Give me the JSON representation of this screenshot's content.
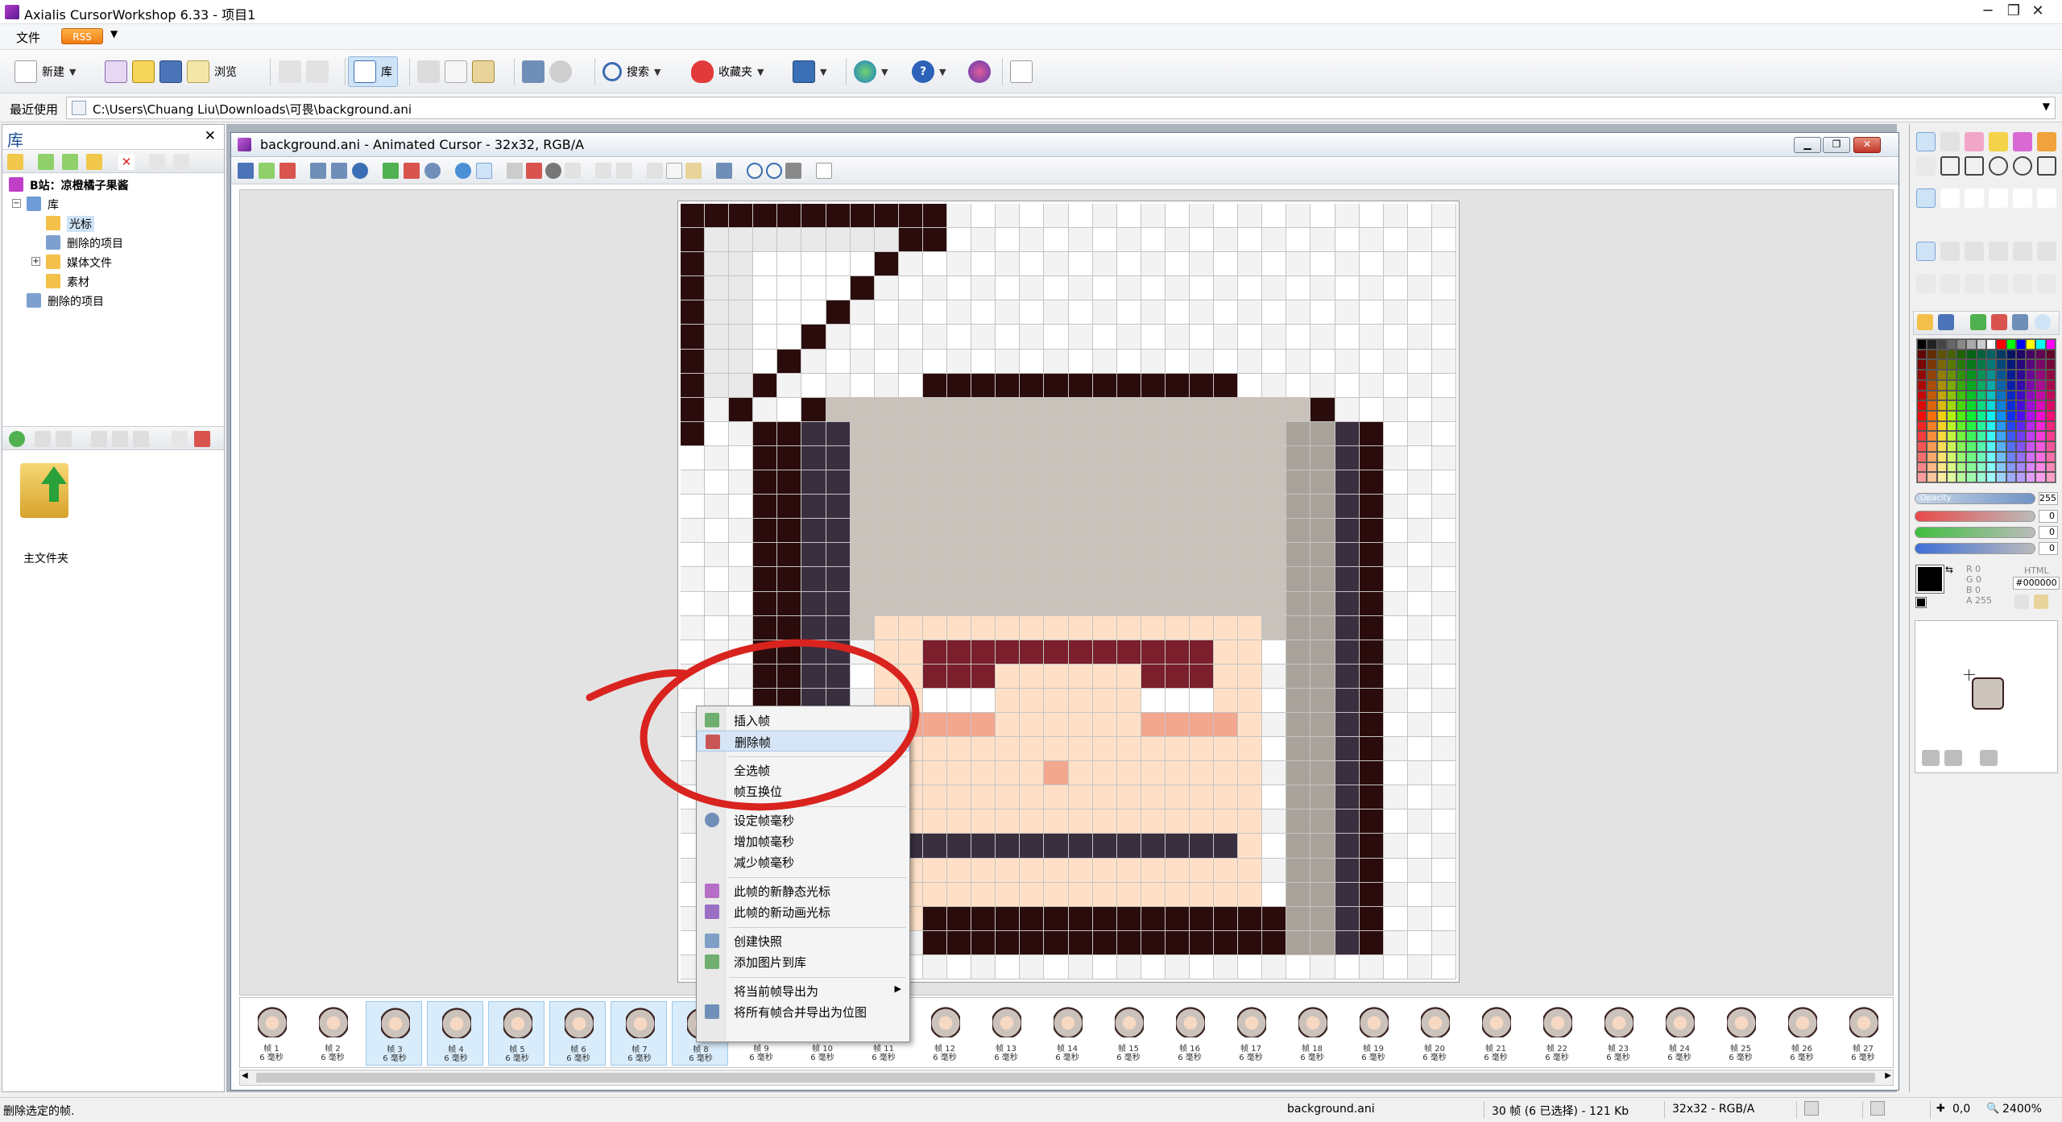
{
  "window": {
    "title": "Axialis CursorWorkshop 6.33 - 项目1"
  },
  "menu": {
    "file": "文件",
    "rss": "RSS"
  },
  "toolbar": {
    "new": "新建",
    "browse": "浏览",
    "library": "库",
    "search": "搜索",
    "favorites": "收藏夹"
  },
  "recent": {
    "label": "最近使用",
    "path": "C:\\Users\\Chuang Liu\\Downloads\\可畏\\background.ani"
  },
  "library": {
    "title": "库",
    "tree": [
      {
        "label": "B站：凉橙橘子果酱",
        "indent": 0
      },
      {
        "label": "库",
        "indent": 1
      },
      {
        "label": "光标",
        "indent": 2
      },
      {
        "label": "删除的项目",
        "indent": 2
      },
      {
        "label": "媒体文件",
        "indent": 2
      },
      {
        "label": "素材",
        "indent": 2
      },
      {
        "label": "删除的项目",
        "indent": 1
      }
    ],
    "folder_label": "主文件夹"
  },
  "document": {
    "title": "background.ani - Animated Cursor - 32x32, RGB/A"
  },
  "frames": {
    "unit": "6 毫秒",
    "prefix": "帧"
  },
  "context_menu": {
    "items": [
      {
        "label": "插入帧"
      },
      {
        "label": "删除帧"
      },
      {
        "label": "全选帧"
      },
      {
        "label": "帧互换位"
      },
      {
        "label": "设定帧毫秒"
      },
      {
        "label": "增加帧毫秒"
      },
      {
        "label": "减少帧毫秒"
      },
      {
        "label": "此帧的新静态光标"
      },
      {
        "label": "此帧的新动画光标"
      },
      {
        "label": "创建快照"
      },
      {
        "label": "添加图片到库"
      },
      {
        "label": "将当前帧导出为"
      },
      {
        "label": "将所有帧合并导出为位图"
      }
    ]
  },
  "color_panel": {
    "opacity_label": "Opacity",
    "opacity": "255",
    "v1": "0",
    "v2": "0",
    "v3": "0",
    "html_label": "HTML",
    "html": "#000000",
    "r_label": "R",
    "g_label": "G",
    "b_label": "B",
    "a_label": "A",
    "r": "0",
    "g": "0",
    "b": "0",
    "a": "255"
  },
  "status": {
    "hint": "删除选定的帧.",
    "file": "background.ani",
    "frames": "30 帧 (6 已选择) - 121 Kb",
    "format": "32x32 - RGB/A",
    "coord": "0,0",
    "zoom": "2400%"
  },
  "colors": {
    "accent": "#1d4f91",
    "annotation": "#d9231e"
  }
}
